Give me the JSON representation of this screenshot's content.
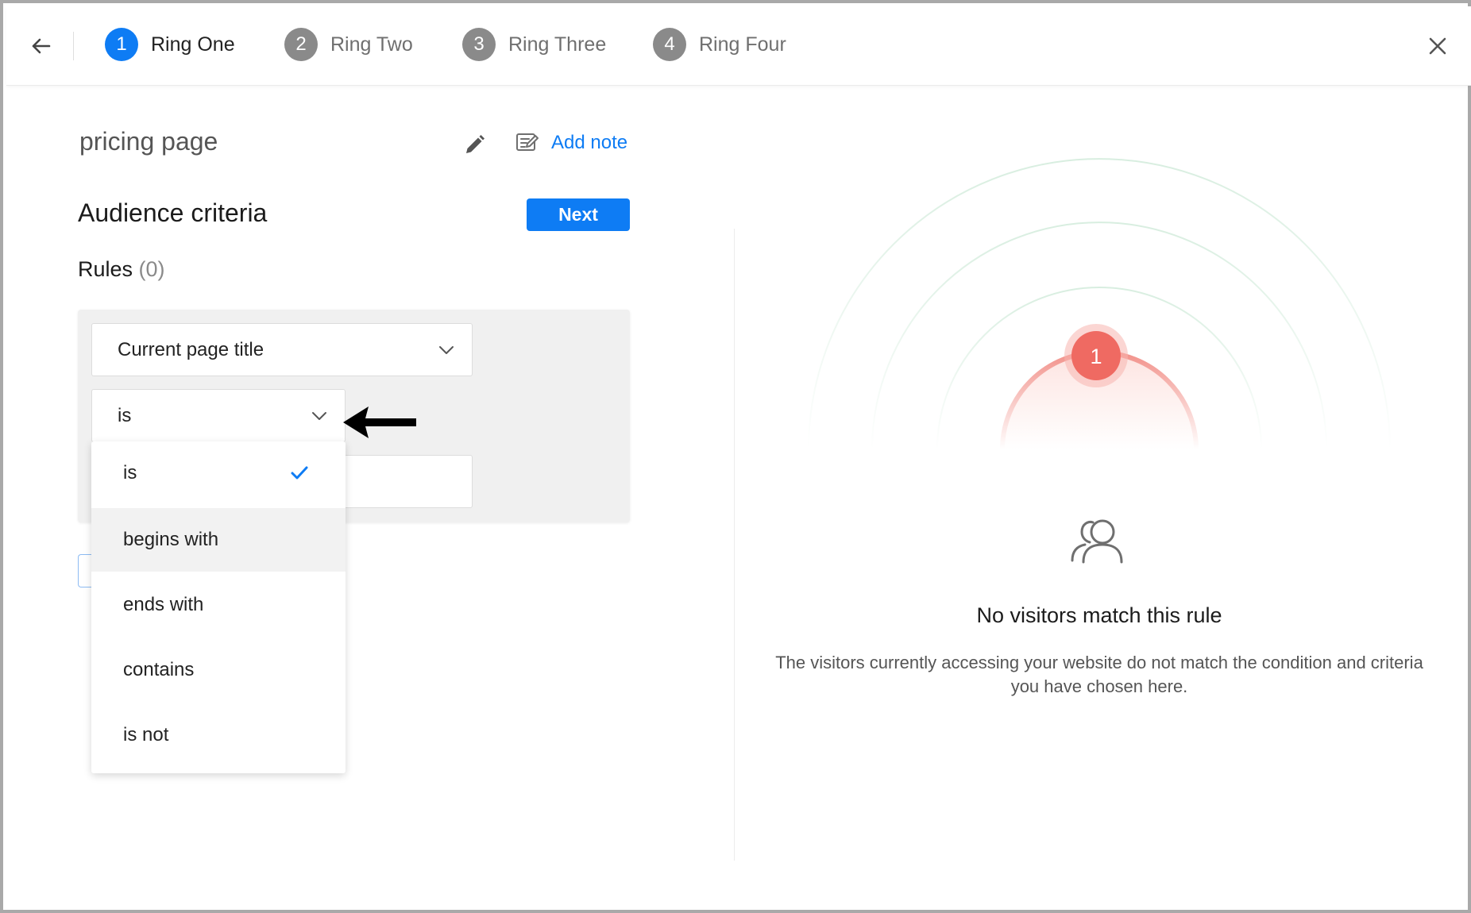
{
  "header": {
    "steps": [
      {
        "num": "1",
        "label": "Ring One",
        "active": true
      },
      {
        "num": "2",
        "label": "Ring Two",
        "active": false
      },
      {
        "num": "3",
        "label": "Ring Three",
        "active": false
      },
      {
        "num": "4",
        "label": "Ring Four",
        "active": false
      }
    ]
  },
  "rule": {
    "name": "pricing page",
    "add_note": "Add note"
  },
  "criteria": {
    "title": "Audience criteria",
    "next_label": "Next",
    "rules_label": "Rules",
    "rules_count": "(0)",
    "field_value": "Current page title",
    "operator_value": "is"
  },
  "dropdown": {
    "options": [
      "is",
      "begins with",
      "ends with",
      "contains",
      "is not"
    ],
    "selected": "is",
    "hovered": "begins with"
  },
  "preview": {
    "badge": "1",
    "empty_title": "No visitors match this rule",
    "empty_desc_line1": "The visitors currently accessing your website do not match the condition and criteria",
    "empty_desc_line2": "you have chosen here."
  },
  "colors": {
    "accent": "#0e7cf4",
    "step_inactive": "#8a8a8a",
    "badge": "#ef6a62"
  },
  "icons": [
    "back-arrow-icon",
    "close-icon",
    "pencil-icon",
    "note-icon",
    "chevron-down-icon",
    "check-icon",
    "users-icon"
  ]
}
